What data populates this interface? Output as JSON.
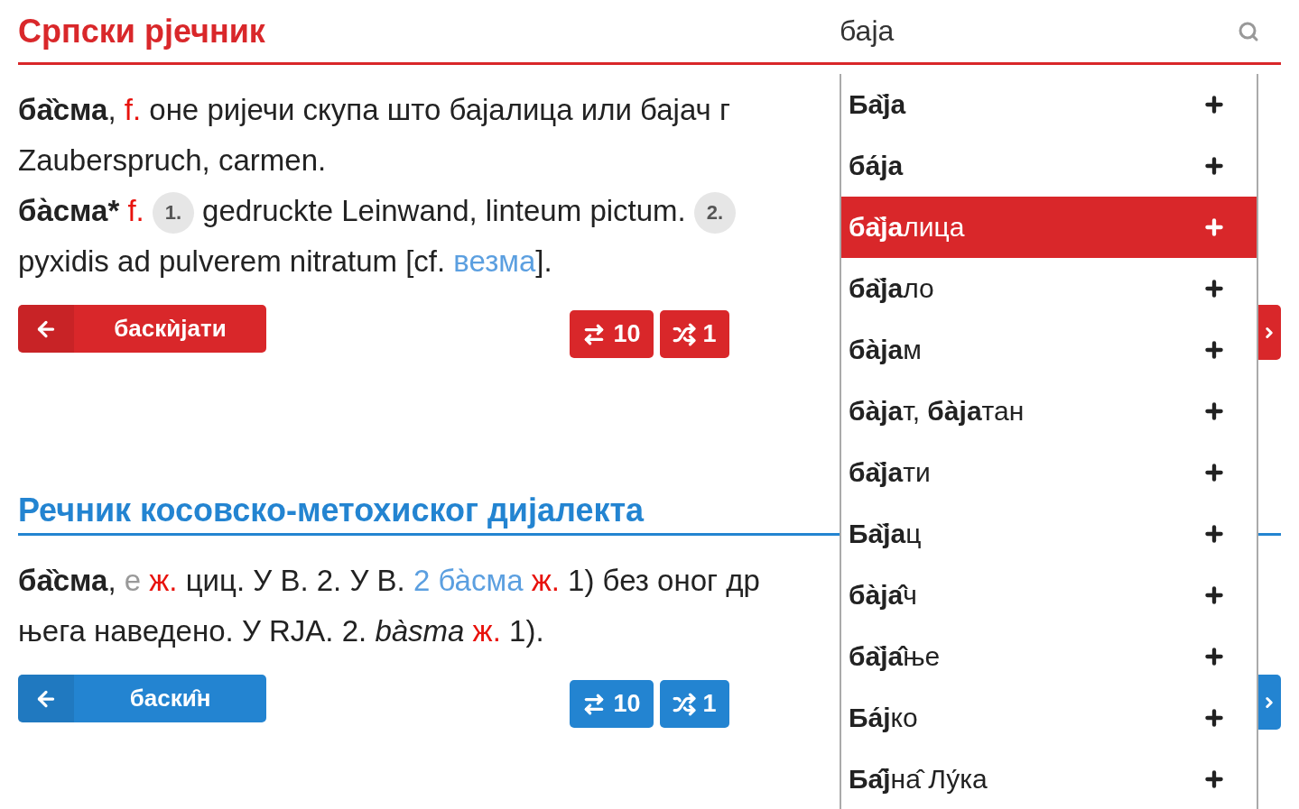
{
  "header": {
    "title": "Српски рјечник",
    "search": {
      "value": "баја"
    }
  },
  "sections": [
    {
      "color": "#d9272a",
      "entries": [
        {
          "lines": [
            [
              {
                "kind": "head",
                "text": "ба̏сма"
              },
              {
                "kind": "plain",
                "text": ", "
              },
              {
                "kind": "gram",
                "text": "f."
              },
              {
                "kind": "plain",
                "text": " оне ријечи скупа што бајалица или бајач г"
              }
            ],
            [
              {
                "kind": "plain",
                "text": "Zauberspruch, carmen."
              }
            ]
          ]
        },
        {
          "lines": [
            [
              {
                "kind": "head",
                "text": "ба̀сма* "
              },
              {
                "kind": "gram",
                "text": "f. "
              },
              {
                "kind": "num",
                "text": "1."
              },
              {
                "kind": "plain",
                "text": " gedruckte Leinwand, linteum pictum. "
              },
              {
                "kind": "num",
                "text": "2."
              }
            ],
            [
              {
                "kind": "plain",
                "text": "pyxidis ad pulverem nitratum [cf. "
              },
              {
                "kind": "link",
                "text": "везма"
              },
              {
                "kind": "plain",
                "text": "]."
              }
            ]
          ]
        }
      ],
      "nav": {
        "prev": "баскѝјати",
        "count_all": "10",
        "count_random": "1"
      }
    },
    {
      "color": "#2384d1",
      "title": "Речник косовско-метохиског дијалекта",
      "entries": [
        {
          "lines": [
            [
              {
                "kind": "head",
                "text": "ба̏сма"
              },
              {
                "kind": "plain",
                "text": ", "
              },
              {
                "kind": "muted",
                "text": "е "
              },
              {
                "kind": "gram",
                "text": "ж."
              },
              {
                "kind": "plain",
                "text": " циц. У В. 2. У В. "
              },
              {
                "kind": "link",
                "text": "2 ба̀сма"
              },
              {
                "kind": "gram",
                "text": " ж."
              },
              {
                "kind": "plain",
                "text": " 1) без оног др"
              }
            ],
            [
              {
                "kind": "plain",
                "text": "њега наведено. У RJA. 2. "
              },
              {
                "kind": "italic",
                "text": "bàsma"
              },
              {
                "kind": "gram",
                "text": " ж."
              },
              {
                "kind": "plain",
                "text": " 1)."
              }
            ]
          ]
        }
      ],
      "nav": {
        "prev": "баски̑н",
        "count_all": "10",
        "count_random": "1"
      }
    }
  ],
  "suggestions": [
    {
      "label": "**Ба̏ја**",
      "selected": false
    },
    {
      "label": "**ба́ја**",
      "selected": false
    },
    {
      "label": "**ба̏ја**лица",
      "selected": true
    },
    {
      "label": "**ба̏ја**ло",
      "selected": false
    },
    {
      "label": "**ба̀ја**м",
      "selected": false
    },
    {
      "label": "**ба̀ја**т, **ба̀ја**тан",
      "selected": false
    },
    {
      "label": "**ба̏ја**ти",
      "selected": false
    },
    {
      "label": "**Ба̏ја**ц",
      "selected": false
    },
    {
      "label": "**ба̀ја̂**ч",
      "selected": false
    },
    {
      "label": "**ба̏ја̂**ње",
      "selected": false
    },
    {
      "label": "**Ба́ј**ко",
      "selected": false
    },
    {
      "label": "**Ба̂ј**на̂ Лу́ка",
      "selected": false
    }
  ]
}
